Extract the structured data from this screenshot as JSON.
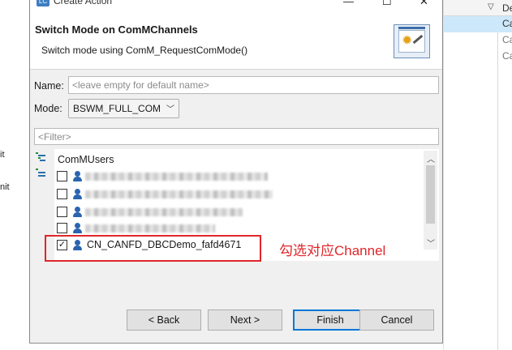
{
  "background": {
    "left_fragments": [
      "it",
      "nit"
    ],
    "right_header": "De",
    "right_rows": [
      "Ca",
      "Ca",
      "Ca"
    ]
  },
  "window": {
    "title": "Create Action",
    "app_icon": "LC",
    "minimize_glyph": "—",
    "maximize_glyph": "☐",
    "close_glyph": "✕"
  },
  "header": {
    "title": "Switch Mode on ComMChannels",
    "description": "Switch mode using ComM_RequestComMode()"
  },
  "form": {
    "name_label": "Name:",
    "name_value": "",
    "name_placeholder": "<leave empty for default name>",
    "mode_label": "Mode:",
    "mode_value": "BSWM_FULL_COM",
    "filter_placeholder": "<Filter>"
  },
  "tree": {
    "root_label": "ComMUsers",
    "items": [
      {
        "label": "",
        "checked": false,
        "obscured": true
      },
      {
        "label": "",
        "checked": false,
        "obscured": true
      },
      {
        "label": "",
        "checked": false,
        "obscured": true
      },
      {
        "label": "",
        "checked": false,
        "obscured": true
      },
      {
        "label": "CN_CANFD_DBCDemo_fafd4671",
        "checked": true,
        "obscured": false
      }
    ]
  },
  "annotation": {
    "text": "勾选对应Channel",
    "color": "#e0262a"
  },
  "buttons": {
    "back": "< Back",
    "next": "Next >",
    "finish": "Finish",
    "cancel": "Cancel"
  },
  "colors": {
    "accent": "#0078d7",
    "selection": "#cde8fa",
    "user_icon": "#2a64b0"
  }
}
